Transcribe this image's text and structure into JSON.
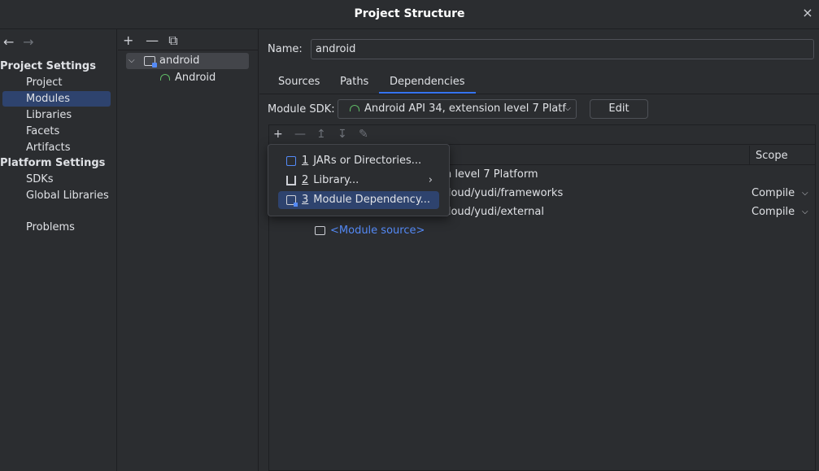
{
  "window": {
    "title": "Project Structure",
    "close_icon": "×"
  },
  "nav": {
    "back": "←",
    "forward": "→"
  },
  "sidebar": {
    "project_settings_header": "Project Settings",
    "project_items": [
      {
        "label": "Project"
      },
      {
        "label": "Modules",
        "selected": true
      },
      {
        "label": "Libraries"
      },
      {
        "label": "Facets"
      },
      {
        "label": "Artifacts"
      }
    ],
    "platform_settings_header": "Platform Settings",
    "platform_items": [
      {
        "label": "SDKs"
      },
      {
        "label": "Global Libraries"
      }
    ],
    "problems_label": "Problems"
  },
  "module_tree": {
    "toolbar": {
      "add": "+",
      "remove": "—",
      "copy": "⧉"
    },
    "module_name": "android",
    "facet_name": "Android"
  },
  "main": {
    "name_label": "Name:",
    "name_value": "android",
    "tabs": [
      {
        "label": "Sources"
      },
      {
        "label": "Paths"
      },
      {
        "label": "Dependencies",
        "active": true
      }
    ],
    "sdk_label": "Module SDK:",
    "sdk_value": "Android API 34, extension level 7 Platf",
    "edit_label": "Edit",
    "dependencies": {
      "scope_header": "Scope",
      "rows": [
        {
          "text": "on level 7 Platform",
          "scope": ""
        },
        {
          "text": "-cloud/yudi/frameworks",
          "scope": "Compile"
        },
        {
          "text": "-cloud/yudi/external",
          "scope": "Compile"
        },
        {
          "text": "<Module source>",
          "scope": ""
        }
      ]
    }
  },
  "popup": {
    "items": [
      {
        "num": "1",
        "label": "JARs or Directories..."
      },
      {
        "num": "2",
        "label": "Library...",
        "submenu": "›"
      },
      {
        "num": "3",
        "label": "Module Dependency...",
        "selected": true
      }
    ]
  },
  "colors": {
    "accent": "#3574f0",
    "selection": "#2e436e",
    "android_green": "#5fb865",
    "link": "#548af7"
  }
}
